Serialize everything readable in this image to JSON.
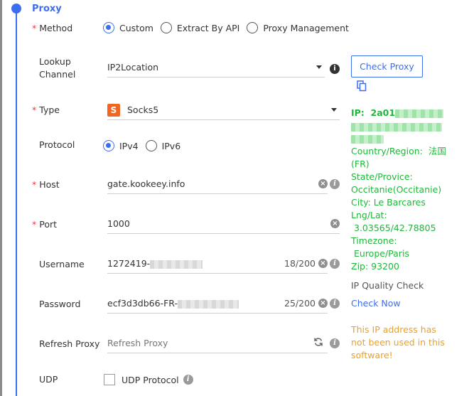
{
  "section": {
    "title": "Proxy"
  },
  "method": {
    "label": "Method",
    "options": [
      "Custom",
      "Extract By API",
      "Proxy Management"
    ],
    "selected": "Custom"
  },
  "lookup": {
    "label_line1": "Lookup",
    "label_line2": "Channel",
    "value": "IP2Location",
    "button": "Check Proxy"
  },
  "type": {
    "label": "Type",
    "value": "Socks5",
    "icon_letter": "S"
  },
  "protocol": {
    "label": "Protocol",
    "options": [
      "IPv4",
      "IPv6"
    ],
    "selected": "IPv4"
  },
  "host": {
    "label": "Host",
    "value": "gate.kookeey.info"
  },
  "port": {
    "label": "Port",
    "value": "1000"
  },
  "username": {
    "label": "Username",
    "value": "1272419-",
    "counter": "18/200"
  },
  "password": {
    "label": "Password",
    "value": "ecf3d3db66-FR-",
    "counter": "25/200"
  },
  "refresh": {
    "label": "Refresh Proxy",
    "placeholder": "Refresh Proxy"
  },
  "udp": {
    "label": "UDP",
    "option": "UDP Protocol"
  },
  "ip_info": {
    "ip_label": "IP:",
    "ip_value": "2a01",
    "country_label": "Country/Region:",
    "country_value": "法国",
    "country_code": "(FR)",
    "state_label": "State/Provice:",
    "state_value": "Occitanie(Occitanie)",
    "city": "City: Le Barcares",
    "lnglat_label": "Lng/Lat:",
    "lnglat_value": "3.03565/42.78805",
    "timezone_label": "Timezone:",
    "timezone_value": "Europe/Paris",
    "zip": "Zip:  93200"
  },
  "quality": {
    "title": "IP Quality Check",
    "link": "Check Now"
  },
  "notice": {
    "line1": "This IP address has",
    "line2": "not been used in this",
    "line3": "software!"
  },
  "colors": {
    "accent": "#3d6ef0",
    "success": "#1fb83a",
    "warning": "#f0a020",
    "required": "#e8383d"
  }
}
